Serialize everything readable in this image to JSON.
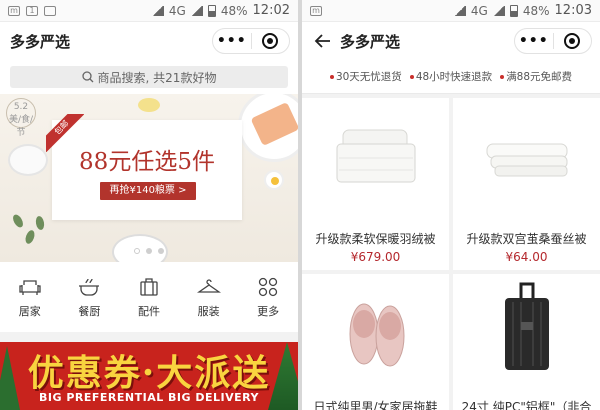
{
  "left": {
    "status": {
      "network": "4G",
      "battery": "48%",
      "time": "12:02"
    },
    "nav": {
      "title": "多多严选",
      "more": "•••"
    },
    "search": {
      "placeholder": "商品搜索, 共21款好物"
    },
    "banner": {
      "badge": "5.2 美/食/节",
      "ribbon": "包邮",
      "title": "88元任选5件",
      "button": "再抢¥140粮票 >"
    },
    "categories": [
      {
        "label": "居家",
        "icon": "sofa-icon"
      },
      {
        "label": "餐厨",
        "icon": "cookware-icon"
      },
      {
        "label": "配件",
        "icon": "luggage-icon"
      },
      {
        "label": "服装",
        "icon": "hanger-icon"
      },
      {
        "label": "更多",
        "icon": "grid-icon"
      }
    ],
    "promo": {
      "title": "优惠券·大派送",
      "subtitle": "BIG PREFERENTIAL BIG DELIVERY"
    }
  },
  "right": {
    "status": {
      "network": "4G",
      "battery": "48%",
      "time": "12:03"
    },
    "nav": {
      "title": "多多严选",
      "more": "•••"
    },
    "promises": [
      "30天无忧退货",
      "48小时快速退款",
      "满88元免邮费"
    ],
    "products": [
      {
        "name": "升级款柔软保暖羽绒被",
        "price": "¥679.00",
        "icon": "duvet-icon"
      },
      {
        "name": "升级款双宫茧桑蚕丝被",
        "price": "¥64.00",
        "icon": "silk-quilt-icon"
      },
      {
        "name": "日式纯里男/女家居拖鞋",
        "price": "",
        "icon": "slippers-icon"
      },
      {
        "name": "24寸 纯PC\"铝框\"（非合",
        "price": "",
        "icon": "suitcase-icon"
      }
    ]
  },
  "colors": {
    "accent": "#b4282d",
    "promo_bg": "#c8231d",
    "promo_text": "#f9d43f"
  }
}
